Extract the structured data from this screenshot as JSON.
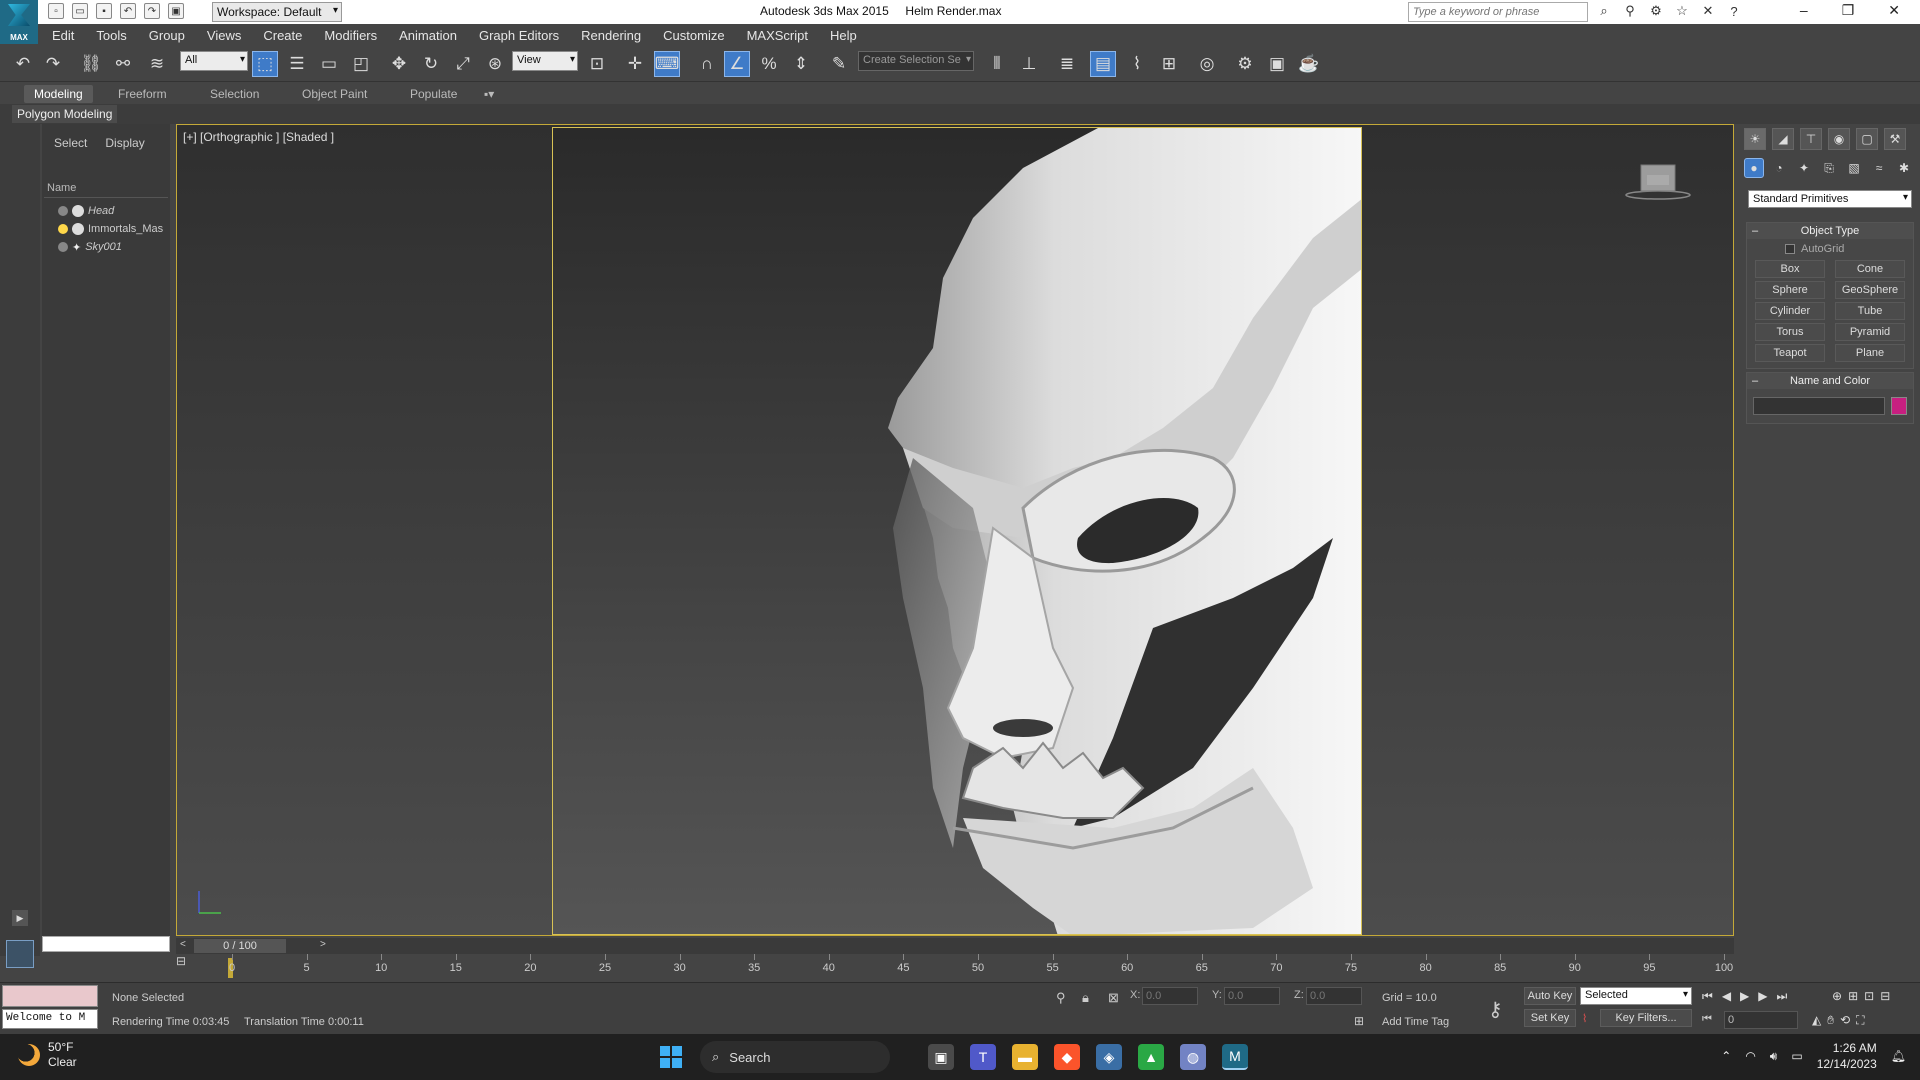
{
  "titlebar": {
    "workspace": "Workspace: Default",
    "app_name": "Autodesk 3ds Max  2015",
    "file_name": "Helm Render.max",
    "search_placeholder": "Type a keyword or phrase",
    "logo_text": "MAX"
  },
  "menu": [
    "Edit",
    "Tools",
    "Group",
    "Views",
    "Create",
    "Modifiers",
    "Animation",
    "Graph Editors",
    "Rendering",
    "Customize",
    "MAXScript",
    "Help"
  ],
  "toolbar": {
    "selection_filter": "All",
    "ref_coord": "View",
    "named_selection": "Create Selection Se"
  },
  "ribbon": {
    "tabs": [
      "Modeling",
      "Freeform",
      "Selection",
      "Object Paint",
      "Populate"
    ],
    "active_tab": "Modeling",
    "panel_label": "Polygon Modeling"
  },
  "scene_explorer": {
    "tabs": [
      "Select",
      "Display"
    ],
    "column_header": "Name",
    "items": [
      {
        "name": "Head",
        "italic": true,
        "light_on": false
      },
      {
        "name": "Immortals_Mas",
        "italic": false,
        "light_on": true
      },
      {
        "name": "Sky001",
        "italic": true,
        "light_on": false
      }
    ]
  },
  "viewport": {
    "label": "[+] [Orthographic ] [Shaded ]"
  },
  "command_panel": {
    "primitive_type": "Standard Primitives",
    "object_type_title": "Object Type",
    "autogrid_label": "AutoGrid",
    "primitives": [
      "Box",
      "Cone",
      "Sphere",
      "GeoSphere",
      "Cylinder",
      "Tube",
      "Torus",
      "Pyramid",
      "Teapot",
      "Plane"
    ],
    "name_color_title": "Name and Color",
    "object_color": "#c71f80"
  },
  "timeline": {
    "frame_display": "0 / 100",
    "ticks": [
      0,
      5,
      10,
      15,
      20,
      25,
      30,
      35,
      40,
      45,
      50,
      55,
      60,
      65,
      70,
      75,
      80,
      85,
      90,
      95,
      100
    ]
  },
  "status": {
    "maxscript_listener": "Welcome to M",
    "selection_status": "None Selected",
    "rendering_time": "Rendering Time  0:03:45",
    "translation_time": "Translation Time  0:00:11",
    "x_label": "X:",
    "x_value": "0.0",
    "y_label": "Y:",
    "y_value": "0.0",
    "z_label": "Z:",
    "z_value": "0.0",
    "grid": "Grid = 10.0",
    "add_time_tag": "Add Time Tag",
    "auto_key": "Auto Key",
    "set_key": "Set Key",
    "key_mode": "Selected",
    "key_filters": "Key Filters...",
    "current_frame": "0"
  },
  "taskbar": {
    "temperature": "50°F",
    "condition": "Clear",
    "search_label": "Search",
    "time": "1:26 AM",
    "date": "12/14/2023"
  }
}
